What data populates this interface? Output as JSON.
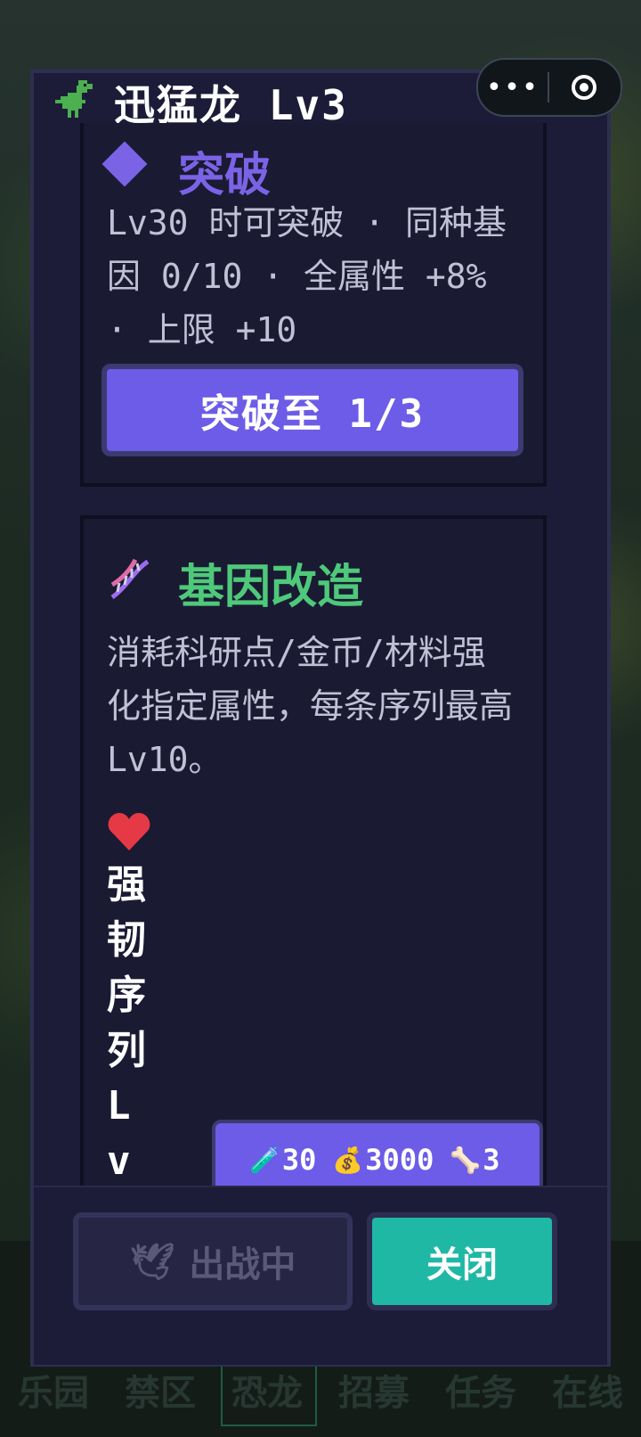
{
  "modal": {
    "title": "迅猛龙 Lv3",
    "dino_icon": "dinosaur-icon"
  },
  "breakthrough": {
    "title": "突破",
    "icon": "diamond-icon",
    "description": "Lv30 时可突破 · 同种基因 0/10 · 全属性 +8% · 上限 +10",
    "button_label": "突破至 1/3"
  },
  "gene_mod": {
    "title": "基因改造",
    "icon": "dna-icon",
    "description": "消耗科研点/金币/材料强化指定属性，每条序列最高 Lv10。",
    "sequence_label": "强韧序列 Lv",
    "sequence_icon": "heart-icon",
    "cost": {
      "research_icon": "test-tube-icon",
      "research": "30",
      "gold_icon": "money-bag-icon",
      "gold": "3000",
      "material_icon": "bone-icon",
      "material": "3"
    }
  },
  "footer": {
    "deploy_label": "出战中",
    "deploy_icon": "dove-icon",
    "close_label": "关闭"
  },
  "bottom_nav": [
    "乐园",
    "禁区",
    "恐龙",
    "招募",
    "任务",
    "在线"
  ],
  "capsule": {
    "more": "•••"
  },
  "colors": {
    "accent_purple": "#6c5ce7",
    "accent_green": "#4ec97a",
    "teal": "#1fb8a5",
    "modal_bg": "#1c1c38"
  }
}
